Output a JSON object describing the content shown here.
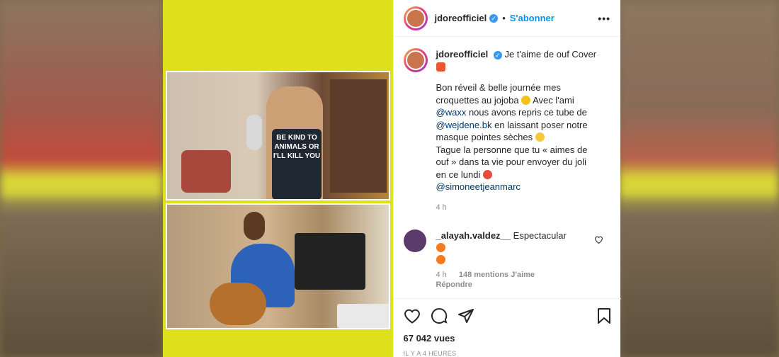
{
  "header": {
    "username": "jdoreofficiel",
    "separator": "•",
    "follow_label": "S'abonner",
    "more_label": "•••"
  },
  "caption": {
    "username": "jdoreofficiel",
    "title": "Je t'aime de ouf Cover",
    "line1": "Bon réveil & belle journée mes croquettes au jojoba",
    "line2_prefix": "Avec l'ami",
    "mention1": "@waxx",
    "line2_suffix": "nous avons repris ce tube de",
    "mention2": "@wejdene.bk",
    "line3": "en laissant poser notre masque pointes sèches",
    "line4": "Tague la personne que tu « aimes de ouf » dans ta vie pour envoyer du joli en ce lundi",
    "mention3": "@simoneetjeanmarc",
    "time": "4 h"
  },
  "comment": {
    "username": "_alayah.valdez__",
    "text": "Espectacular",
    "time": "4 h",
    "likes": "148 mentions J'aime",
    "reply_label": "Répondre"
  },
  "actions": {
    "views": "67 042 vues",
    "ago": "IL Y A 4 HEURES"
  },
  "media": {
    "shirt_text": "BE KIND TO ANIMALS OR I'LL KILL YOU"
  },
  "colors": {
    "accent": "#0095f6",
    "media_background": "#dfe01c",
    "verified": "#3897f0"
  },
  "icons": [
    "verified-icon",
    "more-icon",
    "heart-outline-icon",
    "comment-icon",
    "share-icon",
    "bookmark-icon"
  ]
}
